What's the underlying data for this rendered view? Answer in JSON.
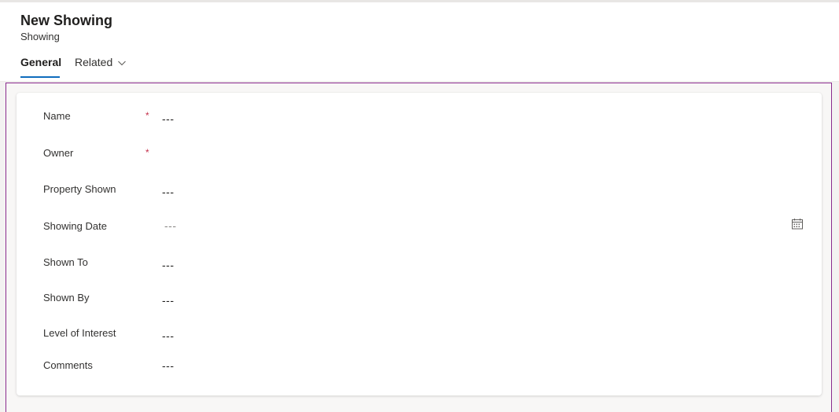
{
  "header": {
    "title": "New Showing",
    "subtitle": "Showing"
  },
  "tabs": [
    {
      "label": "General",
      "selected": true
    },
    {
      "label": "Related",
      "has_dropdown": true
    }
  ],
  "form": {
    "fields": [
      {
        "label": "Name",
        "required": "*",
        "value": "---"
      },
      {
        "label": "Owner",
        "required": "*",
        "value": ""
      },
      {
        "label": "Property Shown",
        "value": "---"
      },
      {
        "label": "Showing Date",
        "value": "---",
        "icon": "calendar-icon"
      },
      {
        "label": "Shown To",
        "value": "---"
      },
      {
        "label": "Shown By",
        "value": "---"
      },
      {
        "label": "Level of Interest",
        "value": "---"
      },
      {
        "label": "Comments",
        "value": "---"
      }
    ]
  },
  "colors": {
    "accent": "#0f6cbd",
    "frame_border": "#8a2b8e",
    "required": "#c4314b"
  }
}
